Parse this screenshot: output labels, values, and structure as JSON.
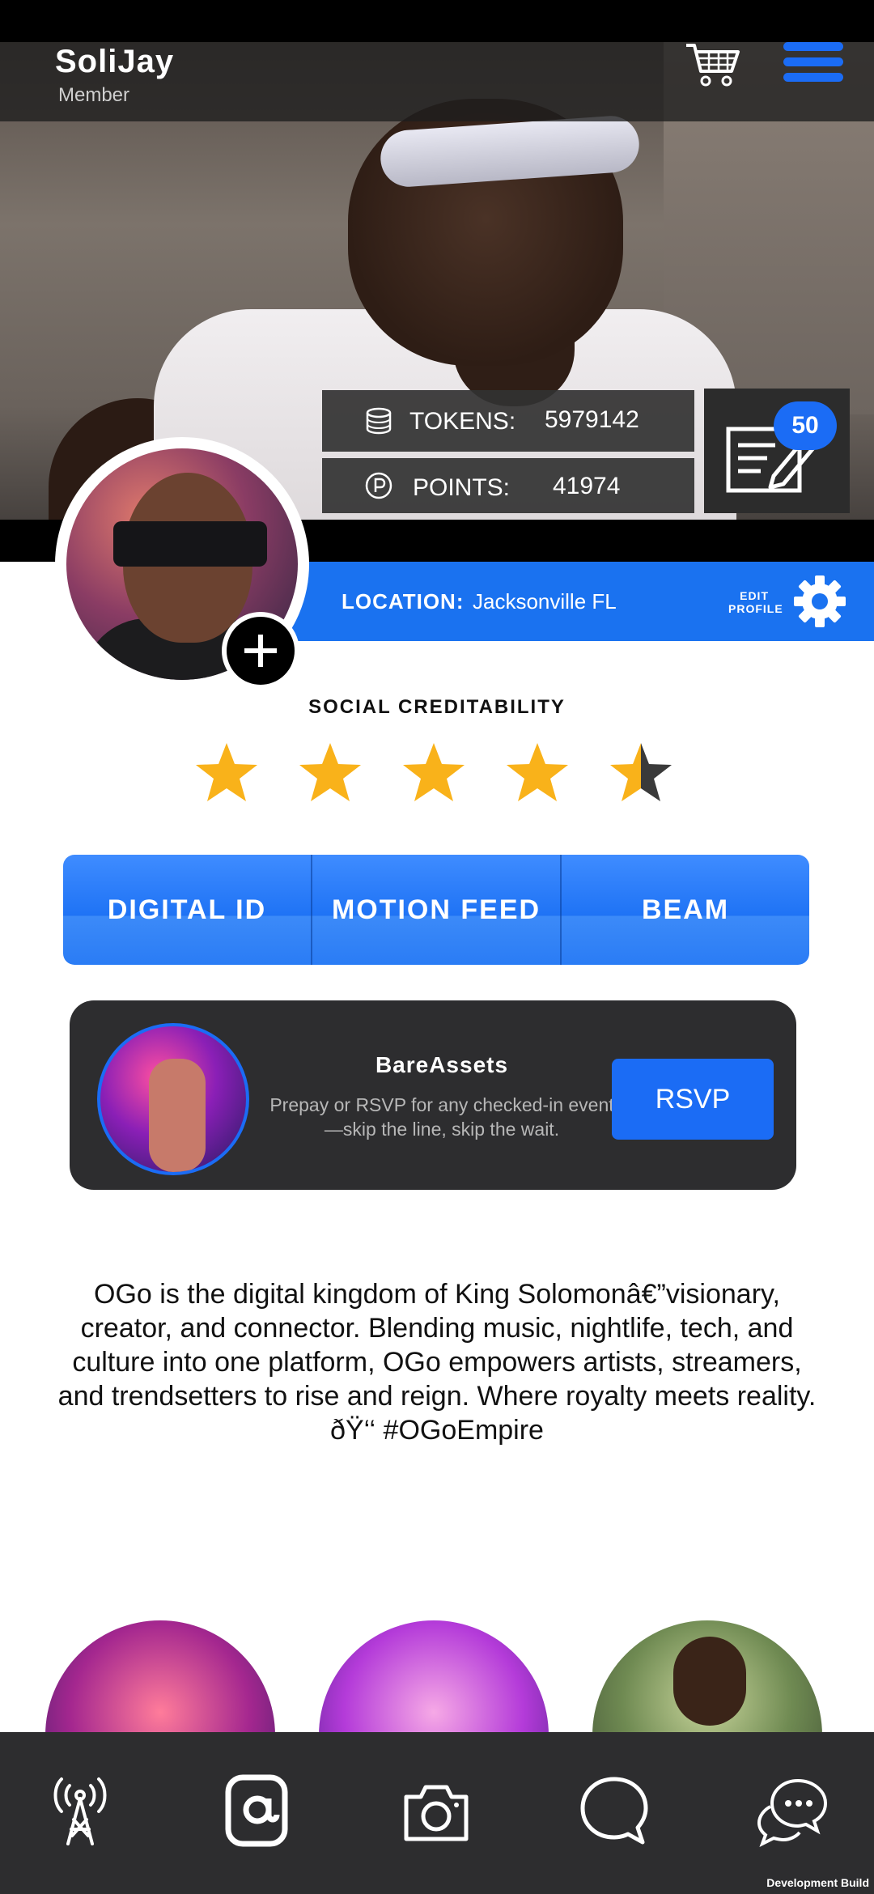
{
  "header": {
    "username": "SoliJay",
    "role": "Member",
    "icons": [
      "cart-icon",
      "hamburger-menu-icon"
    ]
  },
  "stats": {
    "tokens_label": "TOKENS:",
    "tokens_value": "5979142",
    "points_label": "POINTS:",
    "points_value": "41974",
    "notes_badge": "50"
  },
  "location": {
    "label": "LOCATION:",
    "value": "Jacksonville FL",
    "edit_line1": "EDIT",
    "edit_line2": "PROFILE"
  },
  "social": {
    "title": "SOCIAL CREDITABILITY",
    "rating": 4.5,
    "max": 5
  },
  "tabs": [
    "DIGITAL ID",
    "MOTION FEED",
    "BEAM"
  ],
  "promo": {
    "title": "BareAssets",
    "description": "Prepay or RSVP for any checked-in event—skip the line, skip the wait.",
    "button": "RSVP"
  },
  "bio": "OGo is the digital kingdom of King Solomonâ€”visionary, creator, and connector. Blending music, nightlife, tech, and culture into one platform, OGo empowers artists, streamers, and trendsetters to rise and reign. Where royalty meets reality. ðŸ‘‘ #OGoEmpire",
  "nav": [
    "broadcast-tower-icon",
    "at-sign-icon",
    "camera-icon",
    "chat-bubble-icon",
    "messages-icon"
  ],
  "colors": {
    "accent": "#1B6CF5",
    "dark_panel": "#2D2D2F",
    "star": "#F9B21A"
  },
  "footer": "Development Build"
}
